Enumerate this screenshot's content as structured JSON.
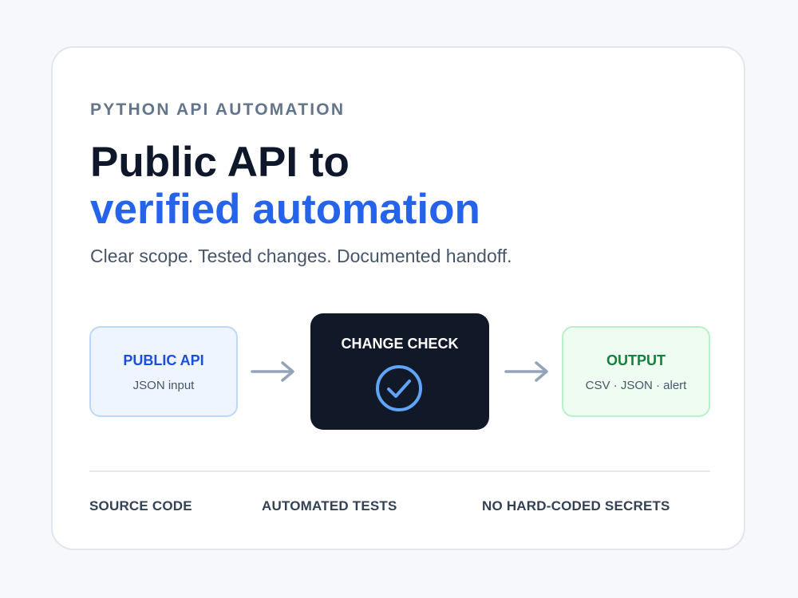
{
  "eyebrow": "PYTHON API AUTOMATION",
  "headline": {
    "line1": "Public API to",
    "line2": "verified automation"
  },
  "subtitle": "Clear scope. Tested changes. Documented handoff.",
  "flow": {
    "source": {
      "title": "PUBLIC API",
      "subtitle": "JSON input"
    },
    "check": {
      "title": "CHANGE CHECK",
      "icon": "check-circle-icon"
    },
    "output": {
      "title": "OUTPUT",
      "subtitle": "CSV · JSON · alert"
    }
  },
  "footer": {
    "items": [
      "SOURCE CODE",
      "AUTOMATED TESTS",
      "NO HARD-CODED SECRETS"
    ]
  },
  "colors": {
    "accent": "#2563eb",
    "dark": "#111827",
    "output_green": "#15803d",
    "check_blue": "#60a5fa"
  }
}
